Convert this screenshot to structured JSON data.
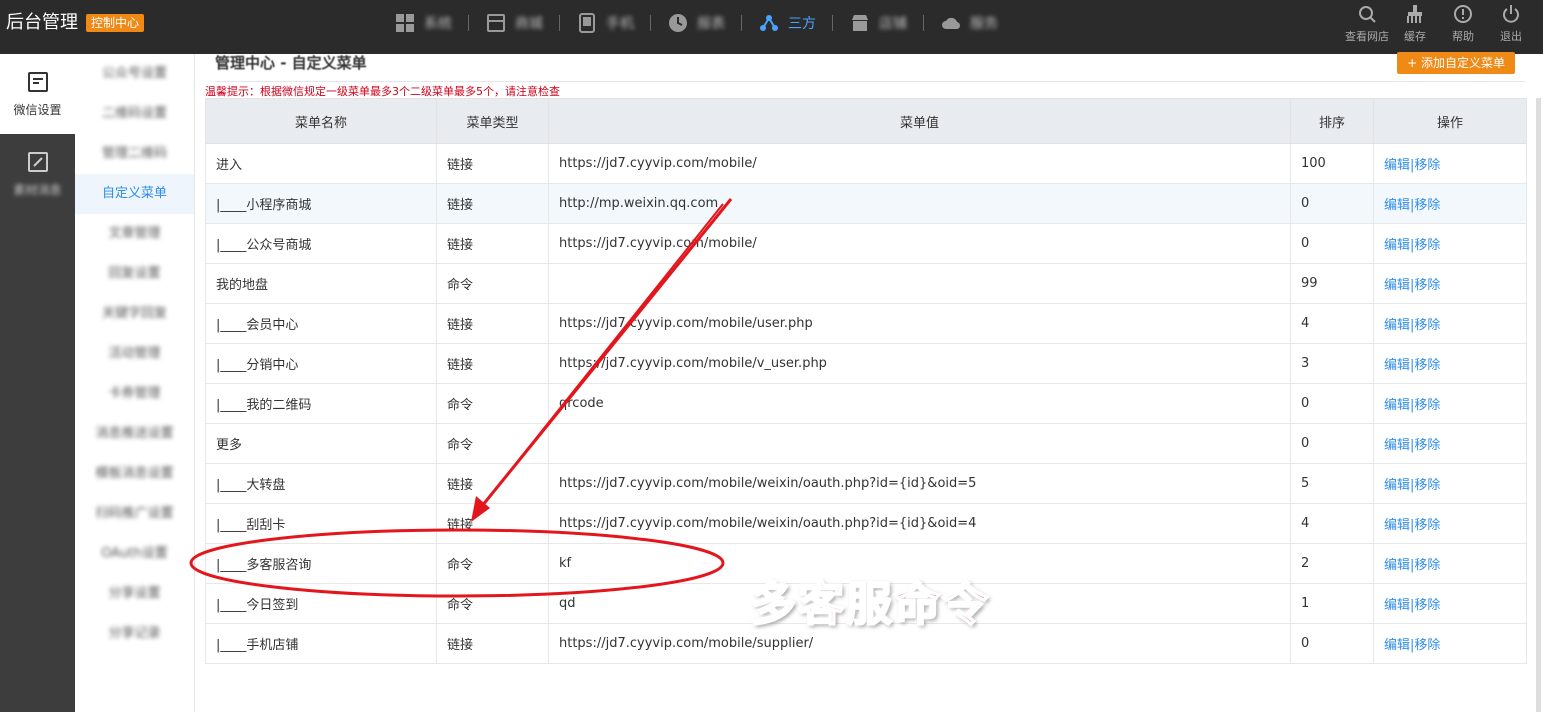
{
  "brand": {
    "title": "后台管理",
    "badge": "控制中心"
  },
  "topnav": [
    {
      "label": "系统",
      "icon": "grid-icon",
      "active": false
    },
    {
      "label": "商城",
      "icon": "store-icon",
      "active": false
    },
    {
      "label": "手机",
      "icon": "mobile-icon",
      "active": false
    },
    {
      "label": "报表",
      "icon": "clock-icon",
      "active": false
    },
    {
      "label": "三方",
      "icon": "network-icon",
      "active": true
    },
    {
      "label": "店铺",
      "icon": "shop-icon",
      "active": false
    },
    {
      "label": "服务",
      "icon": "cloud-icon",
      "active": false
    }
  ],
  "tools": {
    "view_store": "查看网店",
    "cache": "缓存",
    "help": "帮助",
    "logout": "退出"
  },
  "leftnav": {
    "wechat": "微信设置",
    "second": "素材消息"
  },
  "submenu": [
    "公众号设置",
    "二维码设置",
    "管理二维码",
    "自定义菜单",
    "文章管理",
    "回复设置",
    "关键字回复",
    "活动管理",
    "卡券管理",
    "消息推送设置",
    "模板消息设置",
    "扫码推广设置",
    "OAuth设置",
    "分享设置",
    "分享记录"
  ],
  "submenu_active": 3,
  "page": {
    "title": "管理中心 - 自定义菜单",
    "add_button": "+ 添加自定义菜单",
    "tip": "温馨提示：根据微信规定一级菜单最多3个二级菜单最多5个，请注意检查"
  },
  "table": {
    "headers": [
      "菜单名称",
      "菜单类型",
      "菜单值",
      "排序",
      "操作"
    ],
    "edit_label": "编辑",
    "op_sep": "|",
    "remove_label": "移除",
    "rows": [
      {
        "name": "进入",
        "type": "链接",
        "value": "https://jd7.cyyvip.com/mobile/",
        "sort": "100"
      },
      {
        "name": "|____小程序商城",
        "type": "链接",
        "value": "http://mp.weixin.qq.com",
        "sort": "0"
      },
      {
        "name": "|____公众号商城",
        "type": "链接",
        "value": "https://jd7.cyyvip.com/mobile/",
        "sort": "0"
      },
      {
        "name": "我的地盘",
        "type": "命令",
        "value": "",
        "sort": "99"
      },
      {
        "name": "|____会员中心",
        "type": "链接",
        "value": "https://jd7.cyyvip.com/mobile/user.php",
        "sort": "4"
      },
      {
        "name": "|____分销中心",
        "type": "链接",
        "value": "https://jd7.cyyvip.com/mobile/v_user.php",
        "sort": "3"
      },
      {
        "name": "|____我的二维码",
        "type": "命令",
        "value": "qrcode",
        "sort": "0"
      },
      {
        "name": "更多",
        "type": "命令",
        "value": "",
        "sort": "0"
      },
      {
        "name": "|____大转盘",
        "type": "链接",
        "value": "https://jd7.cyyvip.com/mobile/weixin/oauth.php?id={id}&oid=5",
        "sort": "5"
      },
      {
        "name": "|____刮刮卡",
        "type": "链接",
        "value": "https://jd7.cyyvip.com/mobile/weixin/oauth.php?id={id}&oid=4",
        "sort": "4"
      },
      {
        "name": "|____多客服咨询",
        "type": "命令",
        "value": "kf",
        "sort": "2"
      },
      {
        "name": "|____今日签到",
        "type": "命令",
        "value": "qd",
        "sort": "1"
      },
      {
        "name": "|____手机店铺",
        "type": "链接",
        "value": "https://jd7.cyyvip.com/mobile/supplier/",
        "sort": "0"
      }
    ]
  },
  "annotation": {
    "label": "多客服命令",
    "color": "#e2161c"
  },
  "colors": {
    "accent": "#2e8ded",
    "orange": "#f08a17",
    "topbar": "#2b2b2b",
    "tip": "#d0021b"
  }
}
